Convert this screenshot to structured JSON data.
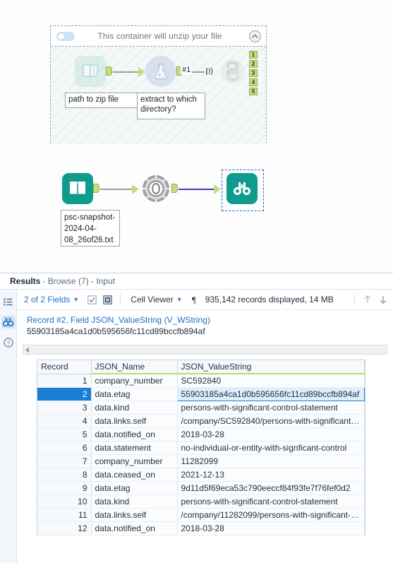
{
  "canvas": {
    "container": {
      "title": "This container will unzip your file",
      "toggle_state": "off",
      "collapse_icon": "chevron-up-icon"
    },
    "container_tools": [
      {
        "name": "input-data-tool",
        "icon": "book-icon",
        "annotation": "path to zip file"
      },
      {
        "name": "run-command-tool",
        "icon": "flask-icon",
        "annotation": "extract to which\ndirectory?"
      },
      {
        "name": "python-tool",
        "icon": "python-icon",
        "annotation": ""
      }
    ],
    "container_annotations": {
      "input": "path to zip file",
      "run_command": "extract to which directory?"
    },
    "connection_label": "#1",
    "python_outputs": [
      "1",
      "2",
      "3",
      "4",
      "5"
    ],
    "lower_tools": [
      {
        "name": "input-data-tool",
        "icon": "book-icon",
        "annotation": "psc-snapshot-2024-04-08_26of26.txt"
      },
      {
        "name": "json-parse-tool",
        "icon": "gear-icon",
        "annotation": ""
      },
      {
        "name": "browse-tool",
        "icon": "binoculars-icon",
        "annotation": "",
        "selected": true
      }
    ],
    "lower_annotation": "psc-snapshot-\n2024-04-\n08_26of26.txt"
  },
  "results": {
    "title": "Results",
    "subtitle": "- Browse (7) - Input",
    "rail": [
      {
        "name": "list-view-icon",
        "label": "list"
      },
      {
        "name": "browse-icon",
        "label": "browse",
        "active": true
      },
      {
        "name": "help-icon",
        "label": "help"
      }
    ],
    "toolbar": {
      "fields_label": "2 of 2 Fields",
      "select_all_icon": "checkbox-checked-icon",
      "deselect_all_icon": "checkbox-x-icon",
      "viewer_label": "Cell Viewer",
      "pilcrow_icon": "pilcrow-icon",
      "records_label": "935,142 records displayed, 14 MB",
      "up_icon": "arrow-up-icon",
      "down_icon": "arrow-down-icon"
    },
    "cell_viewer": {
      "header": "Record #2, Field JSON_ValueString (V_WString)",
      "value": "55903185a4ca1d0b595656fc11cd89bccfb894af"
    },
    "scrollbar": {
      "left_arrow_icon": "triangle-left-icon"
    },
    "table": {
      "columns": [
        "Record",
        "JSON_Name",
        "JSON_ValueString"
      ],
      "selected_record": 2,
      "rows": [
        {
          "record": "1",
          "name": "company_number",
          "value": "SC592840"
        },
        {
          "record": "2",
          "name": "data.etag",
          "value": "55903185a4ca1d0b595656fc11cd89bccfb894af"
        },
        {
          "record": "3",
          "name": "data.kind",
          "value": "persons-with-significant-control-statement"
        },
        {
          "record": "4",
          "name": "data.links.self",
          "value": "/company/SC592840/persons-with-significant-co…"
        },
        {
          "record": "5",
          "name": "data.notified_on",
          "value": "2018-03-28"
        },
        {
          "record": "6",
          "name": "data.statement",
          "value": "no-individual-or-entity-with-signficant-control"
        },
        {
          "record": "7",
          "name": "company_number",
          "value": "11282099"
        },
        {
          "record": "8",
          "name": "data.ceased_on",
          "value": "2021-12-13"
        },
        {
          "record": "9",
          "name": "data.etag",
          "value": "9d11d5f69eca53c790eeccf84f93fe7f76fef0d2"
        },
        {
          "record": "10",
          "name": "data.kind",
          "value": "persons-with-significant-control-statement"
        },
        {
          "record": "11",
          "name": "data.links.self",
          "value": "/company/11282099/persons-with-significant-co …"
        },
        {
          "record": "12",
          "name": "data.notified_on",
          "value": "2018-03-28"
        }
      ]
    }
  },
  "colors": {
    "accent_blue": "#1a7fd4",
    "link_blue": "#1a6fc4",
    "anchor_green": "#c4dd7e",
    "field_green": "#b6de6a",
    "teal": "#0f9b8e",
    "wire_grey": "#9e9e9e",
    "wire_blue": "#3b3bc9"
  }
}
